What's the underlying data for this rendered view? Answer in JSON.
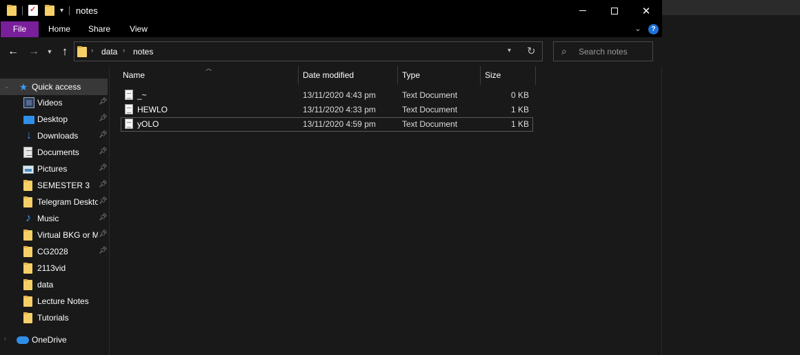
{
  "window": {
    "title": "notes",
    "controls": {
      "minimize": "minimize",
      "maximize": "maximize",
      "close": "✕"
    }
  },
  "ribbon": {
    "tabs": [
      "File",
      "Home",
      "Share",
      "View"
    ],
    "help": "?"
  },
  "address": {
    "crumbs": [
      "data",
      "notes"
    ]
  },
  "search": {
    "placeholder": "Search notes"
  },
  "navpane": {
    "quick_access": "Quick access",
    "items": [
      {
        "label": "Videos",
        "icon": "videos-icon",
        "pinned": true
      },
      {
        "label": "Desktop",
        "icon": "desktop-icon",
        "pinned": true
      },
      {
        "label": "Downloads",
        "icon": "downloads-icon",
        "pinned": true
      },
      {
        "label": "Documents",
        "icon": "documents-icon",
        "pinned": true
      },
      {
        "label": "Pictures",
        "icon": "pictures-icon",
        "pinned": true
      },
      {
        "label": "SEMESTER 3",
        "icon": "folder-icon",
        "pinned": true
      },
      {
        "label": "Telegram Deskto",
        "icon": "folder-icon",
        "pinned": true
      },
      {
        "label": "Music",
        "icon": "music-icon",
        "pinned": true
      },
      {
        "label": "Virtual BKG or M",
        "icon": "folder-icon",
        "pinned": true
      },
      {
        "label": "CG2028",
        "icon": "folder-icon",
        "pinned": true
      },
      {
        "label": "2113vid",
        "icon": "folder-icon",
        "pinned": false
      },
      {
        "label": "data",
        "icon": "folder-icon",
        "pinned": false
      },
      {
        "label": "Lecture Notes",
        "icon": "folder-icon",
        "pinned": false
      },
      {
        "label": "Tutorials",
        "icon": "folder-icon",
        "pinned": false
      }
    ],
    "onedrive": "OneDrive"
  },
  "columns": {
    "name": "Name",
    "date": "Date modified",
    "type": "Type",
    "size": "Size"
  },
  "files": [
    {
      "name": "_~",
      "date": "13/11/2020 4:43 pm",
      "type": "Text Document",
      "size": "0 KB"
    },
    {
      "name": "HEWLO",
      "date": "13/11/2020 4:33 pm",
      "type": "Text Document",
      "size": "1 KB"
    },
    {
      "name": "yOLO",
      "date": "13/11/2020 4:59 pm",
      "type": "Text Document",
      "size": "1 KB"
    }
  ],
  "colors": {
    "file_tab": "#7a1f9c",
    "accent": "#1e72d8",
    "background": "#191919"
  }
}
